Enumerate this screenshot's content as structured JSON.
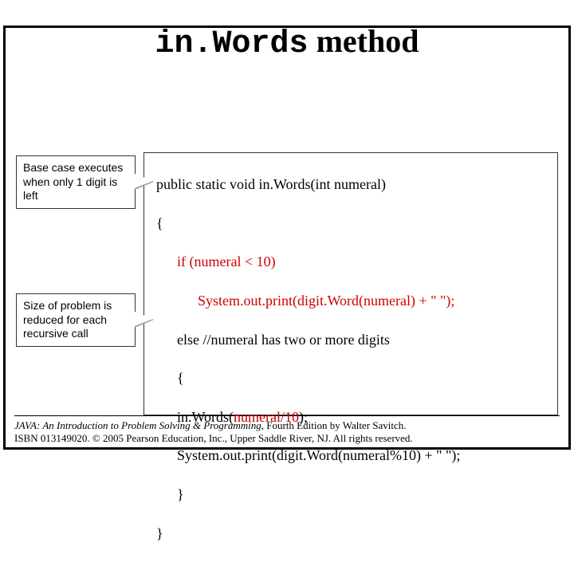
{
  "title": {
    "mono": "in.Words",
    "serif": " method"
  },
  "callouts": [
    {
      "text": "Base case executes when only 1 digit is left"
    },
    {
      "text": "Size of problem is reduced for each recursive call"
    }
  ],
  "code": {
    "l1": "public static void in.Words(int numeral)",
    "l2": "{",
    "l3": "if (numeral < 10)",
    "l4": "System.out.print(digit.Word(numeral) + \" \");",
    "l5": "else //numeral has two or more digits",
    "l6": "{",
    "l7_pre": "in.Words(",
    "l7_arg": "numeral/10",
    "l7_post": ");",
    "l8": "System.out.print(digit.Word(numeral%10) + \" \");",
    "l9": "}",
    "l10": "}"
  },
  "footer": {
    "line1a": "JAVA: An Introduction to Problem Solving & Programming",
    "line1b": ", Fourth Edition by Walter Savitch.",
    "line2": "ISBN 013149020. © 2005 Pearson Education, Inc., Upper Saddle River, NJ. All rights reserved."
  }
}
